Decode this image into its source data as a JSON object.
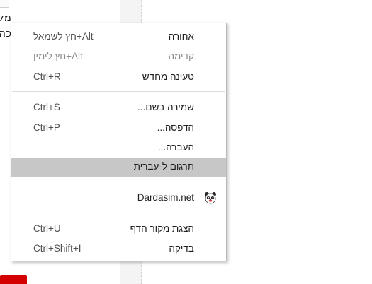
{
  "background": {
    "text_line_1": "מקש",
    "text_line_2": "כה"
  },
  "menu": {
    "items": [
      {
        "label": "אחורה",
        "shortcut": "Alt+חץ לשמאל",
        "disabled": false
      },
      {
        "label": "קדימה",
        "shortcut": "Alt+חץ לימין",
        "disabled": true
      },
      {
        "label": "טעינה מחדש",
        "shortcut": "Ctrl+R",
        "disabled": false
      },
      {
        "label": "שמירה בשם...",
        "shortcut": "Ctrl+S",
        "disabled": false
      },
      {
        "label": "הדפסה...",
        "shortcut": "Ctrl+P",
        "disabled": false
      },
      {
        "label": "העברה...",
        "shortcut": "",
        "disabled": false
      },
      {
        "label": "תרגום ל-עברית",
        "shortcut": "",
        "disabled": false,
        "highlighted": true
      },
      {
        "label": "Dardasim.net",
        "shortcut": "",
        "icon": "panda-extension-icon",
        "disabled": false
      },
      {
        "label": "הצגת מקור הדף",
        "shortcut": "Ctrl+U",
        "disabled": false
      },
      {
        "label": "בדיקה",
        "shortcut": "Ctrl+Shift+I",
        "disabled": false
      }
    ]
  },
  "colors": {
    "highlight": "#c7c7c7",
    "disabled_text": "#8a8a8a",
    "red_button": "#d40000"
  }
}
